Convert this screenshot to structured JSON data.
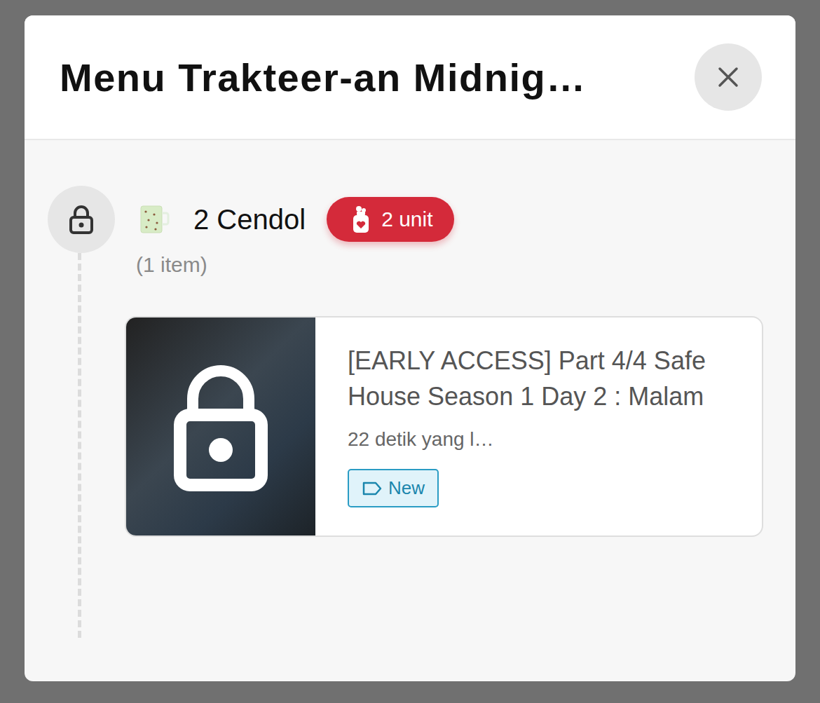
{
  "modal": {
    "title": "Menu Trakteer-an Midnig…"
  },
  "tiers": [
    {
      "name": "2 Cendol",
      "unit": "2 unit",
      "count": "(1 item)",
      "locked": true,
      "items": [
        {
          "title": "[EARLY ACCESS] Part 4/4 Safe House Season 1 Day 2 : Malam",
          "description": "22 detik yang l…",
          "locked": true,
          "tags": [
            "New"
          ]
        }
      ]
    }
  ]
}
